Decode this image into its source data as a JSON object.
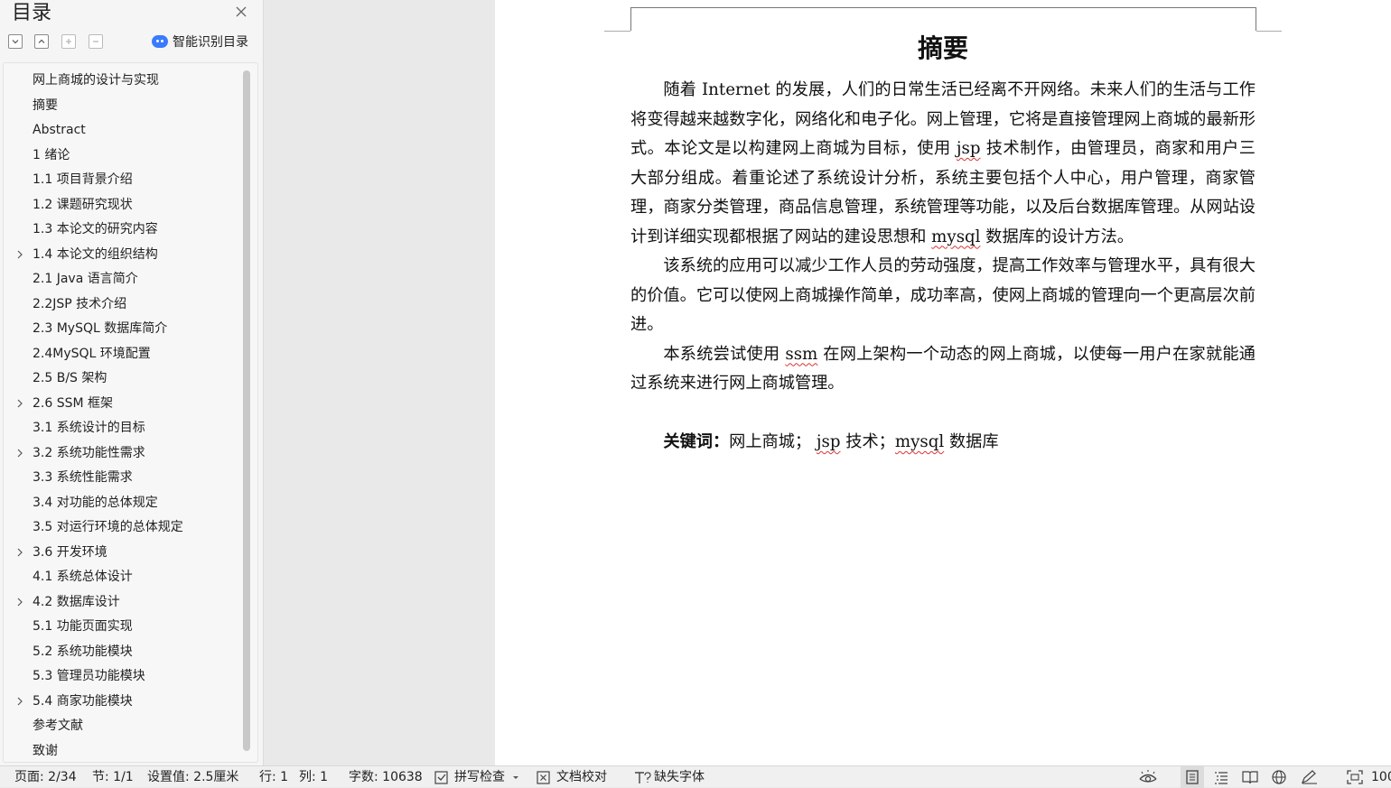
{
  "toc": {
    "title": "目录",
    "smart_label": "智能识别目录",
    "items": [
      {
        "label": "网上商城的设计与实现",
        "expandable": false
      },
      {
        "label": "摘要",
        "expandable": false
      },
      {
        "label": "Abstract",
        "expandable": false
      },
      {
        "label": "1  绪论",
        "expandable": false
      },
      {
        "label": "1.1 项目背景介绍",
        "expandable": false
      },
      {
        "label": "1.2 课题研究现状",
        "expandable": false
      },
      {
        "label": "1.3 本论文的研究内容",
        "expandable": false
      },
      {
        "label": "1.4 本论文的组织结构",
        "expandable": true
      },
      {
        "label": "2.1 Java 语言简介",
        "expandable": false
      },
      {
        "label": "2.2JSP 技术介绍",
        "expandable": false
      },
      {
        "label": "2.3 MySQL 数据库简介",
        "expandable": false
      },
      {
        "label": "2.4MySQL 环境配置",
        "expandable": false
      },
      {
        "label": "2.5 B/S 架构",
        "expandable": false
      },
      {
        "label": "2.6 SSM 框架",
        "expandable": true
      },
      {
        "label": "3.1 系统设计的目标",
        "expandable": false
      },
      {
        "label": "3.2 系统功能性需求",
        "expandable": true
      },
      {
        "label": "3.3 系统性能需求",
        "expandable": false
      },
      {
        "label": "3.4 对功能的总体规定",
        "expandable": false
      },
      {
        "label": "3.5 对运行环境的总体规定",
        "expandable": false
      },
      {
        "label": "3.6 开发环境",
        "expandable": true
      },
      {
        "label": "4.1 系统总体设计",
        "expandable": false
      },
      {
        "label": "4.2 数据库设计",
        "expandable": true
      },
      {
        "label": "5.1 功能页面实现",
        "expandable": false
      },
      {
        "label": "5.2 系统功能模块",
        "expandable": false
      },
      {
        "label": "5.3 管理员功能模块",
        "expandable": false
      },
      {
        "label": "5.4 商家功能模块",
        "expandable": true
      },
      {
        "label": "参考文献",
        "expandable": false
      },
      {
        "label": "致谢",
        "expandable": false
      }
    ]
  },
  "document": {
    "heading": "摘要",
    "p1": [
      "随着 Internet 的发展，人们的日常生活已经离不开网络。未来人们的生活与工作将变得越来越数字化，网络化和电子化。网上管理，它将是直接管理网上商城的最新形式。本论文是以构建网上商城为目标，使用 ",
      "jsp",
      " 技术制作，由管理员，商家和用户三大部分组成。着重论述了系统设计分析，系统主要包括个人中心，用户管理，商家管理，商家分类管理，商品信息管理，系统管理等功能，以及后台数据库管理。从网站设计到详细实现都根据了网站的建设思想和 ",
      "mysql",
      " 数据库的设计方法。"
    ],
    "p2": "该系统的应用可以减少工作人员的劳动强度，提高工作效率与管理水平，具有很大的价值。它可以使网上商城操作简单，成功率高，使网上商城的管理向一个更高层次前进。",
    "p3": [
      "本系统尝试使用 ",
      "ssm",
      " 在网上架构一个动态的网上商城，以使每一用户在家就能通过系统来进行网上商城管理。"
    ],
    "keywords_label": "关键词：",
    "keywords": [
      "网上商城；  ",
      "jsp",
      " 技术；",
      "mysql",
      " 数据库"
    ]
  },
  "status": {
    "page": "页面: 2/34",
    "section": "节: 1/1",
    "setting": "设置值: 2.5厘米",
    "row": "行: 1",
    "col": "列: 1",
    "words": "字数: 10638",
    "spell": "拼写检查",
    "proof": "文档校对",
    "missing_font": "缺失字体",
    "zoom": "100"
  },
  "colors": {
    "accent": "#3a7bfd",
    "squiggle": "#d33"
  }
}
